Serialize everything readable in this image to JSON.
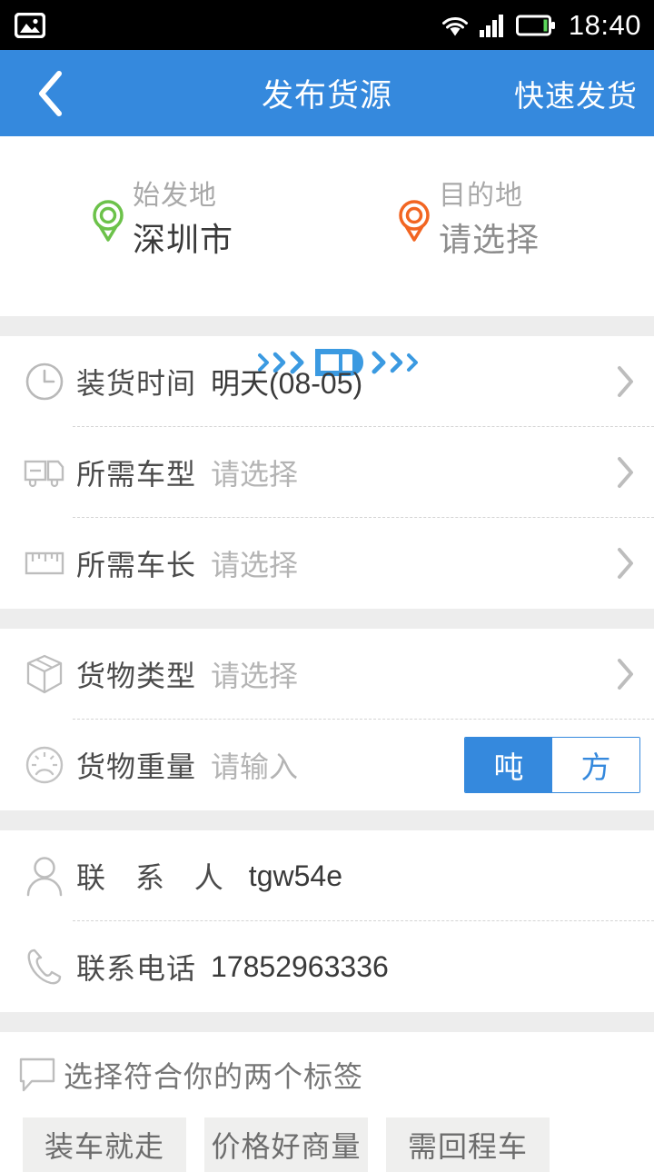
{
  "status_bar": {
    "left_icon": "image-icon",
    "icons": [
      "wifi-icon",
      "signal-icon",
      "battery-icon"
    ],
    "time": "18:40"
  },
  "header": {
    "back_icon": "back-chevron-icon",
    "title": "发布货源",
    "action_label": "快速发货"
  },
  "route": {
    "origin": {
      "pin_icon": "location-pin-green-icon",
      "label": "始发地",
      "value": "深圳市"
    },
    "destination": {
      "pin_icon": "location-pin-orange-icon",
      "label": "目的地",
      "value": "请选择"
    },
    "truck_icon": "truck-top-view-icon",
    "arrow_icon": "chevron-right-icon"
  },
  "form": {
    "section_one": [
      {
        "icon": "clock-icon",
        "label": "装货时间",
        "value": "明天(08-05)",
        "is_placeholder": false,
        "has_chevron": true
      },
      {
        "icon": "truck-side-icon",
        "label": "所需车型",
        "value": "请选择",
        "is_placeholder": true,
        "has_chevron": true
      },
      {
        "icon": "ruler-icon",
        "label": "所需车长",
        "value": "请选择",
        "is_placeholder": true,
        "has_chevron": true
      }
    ],
    "section_two": [
      {
        "icon": "box-icon",
        "label": "货物类型",
        "value": "请选择",
        "is_placeholder": true,
        "has_chevron": true
      },
      {
        "icon": "gauge-icon",
        "label": "货物重量",
        "value": "请输入",
        "is_placeholder": true,
        "has_chevron": false
      }
    ],
    "weight_units": {
      "selected": "吨",
      "options": [
        "吨",
        "方"
      ]
    },
    "section_three": [
      {
        "icon": "person-icon",
        "label": "联 系 人",
        "value": "tgw54e",
        "is_placeholder": false,
        "has_chevron": false
      },
      {
        "icon": "phone-icon",
        "label": "联系电话",
        "value": "17852963336",
        "is_placeholder": false,
        "has_chevron": false
      }
    ]
  },
  "tags": {
    "icon": "comment-bubble-icon",
    "heading": "选择符合你的两个标签",
    "chips": [
      "装车就走",
      "价格好商量",
      "需回程车"
    ]
  },
  "colors": {
    "accent_blue": "#3589dd",
    "origin_green": "#6cc24a",
    "dest_orange": "#f26522",
    "divider_gray": "#ededed",
    "chip_gray": "#efefee"
  }
}
